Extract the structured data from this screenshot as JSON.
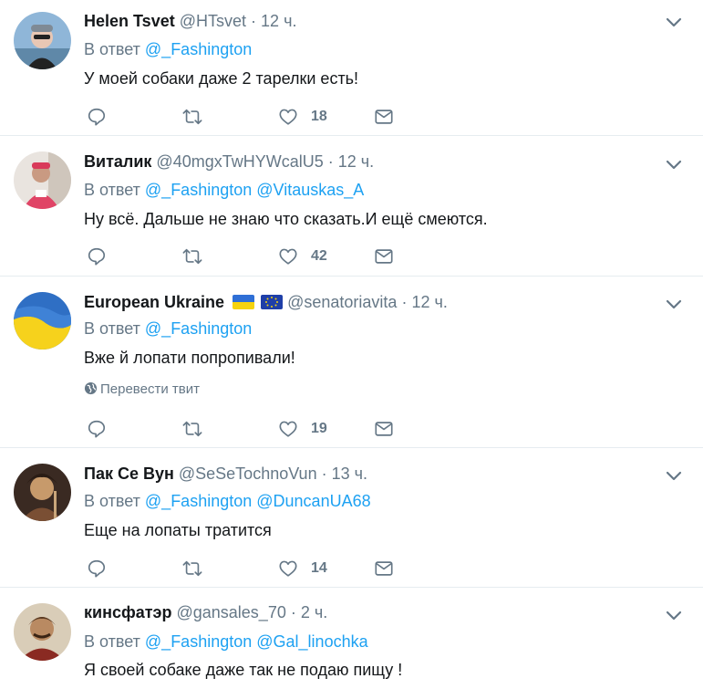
{
  "reply_prefix": "В ответ",
  "translate_label": "Перевести твит",
  "colors": {
    "link": "#1da1f2",
    "muted": "#657786",
    "text": "#14171a",
    "divider": "#e6ecf0"
  },
  "tweets": [
    {
      "name": "Helen Tsvet",
      "handle": "@HTsvet",
      "dot": "·",
      "time": "12 ч.",
      "mentions": [
        "@_Fashington"
      ],
      "text": "У моей собаки даже 2 тарелки есть!",
      "likes": "18"
    },
    {
      "name": "Виталик",
      "handle": "@40mgxTwHYWcalU5",
      "dot": "·",
      "time": "12 ч.",
      "mentions": [
        "@_Fashington",
        "@Vitauskas_A"
      ],
      "text": "Ну всё. Дальше не знаю что сказать.И ещё смеются.",
      "likes": "42"
    },
    {
      "name": "European Ukraine",
      "handle": "@senatoriavita",
      "dot": "·",
      "time": "12 ч.",
      "mentions": [
        "@_Fashington"
      ],
      "text": "Вже й лопати попропивали!",
      "likes": "19"
    },
    {
      "name": "Пак Се Вун",
      "handle": "@SeSeTochnoVun",
      "dot": "·",
      "time": "13 ч.",
      "mentions": [
        "@_Fashington",
        "@DuncanUA68"
      ],
      "text": "Еще на лопаты тратится",
      "likes": "14"
    },
    {
      "name": "кинсфатэр",
      "handle": "@gansales_70",
      "dot": "·",
      "time": "2 ч.",
      "mentions": [
        "@_Fashington",
        "@Gal_linochka"
      ],
      "text": "Я своей собаке даже так не подаю пищу !",
      "likes": ""
    }
  ]
}
